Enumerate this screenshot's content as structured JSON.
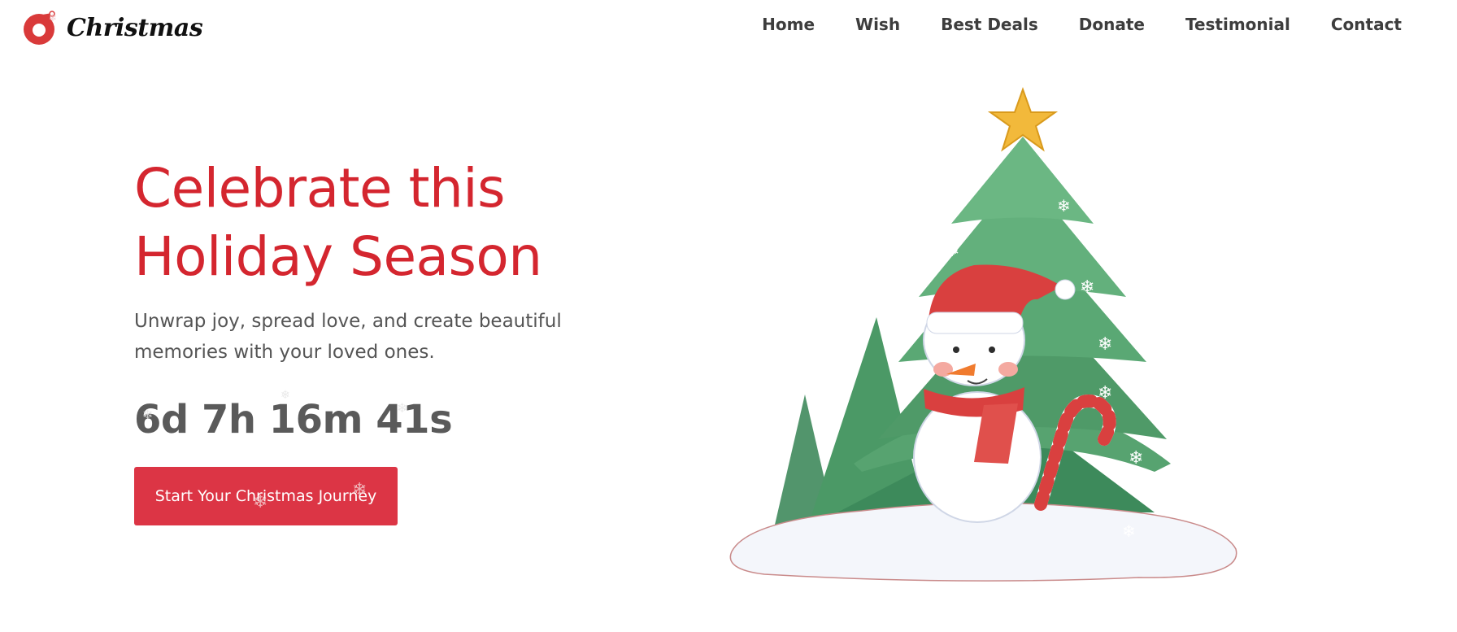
{
  "brand": {
    "name": "Christmas"
  },
  "nav": {
    "items": [
      "Home",
      "Wish",
      "Best Deals",
      "Donate",
      "Testimonial",
      "Contact"
    ]
  },
  "hero": {
    "headline_line1": "Celebrate this",
    "headline_line2": "Holiday Season",
    "subtext": "Unwrap joy, spread love, and create beautiful memories with your loved ones.",
    "countdown": "6d 7h 16m 41s",
    "cta_label": "Start Your Christmas Journey"
  },
  "colors": {
    "accent": "#dc3545",
    "headline": "#d4262f",
    "nav_text": "#3d3d3d",
    "tree": "#4f9a68",
    "star": "#f2b93b"
  },
  "icons": {
    "logo": "christmas-bauble-logo-icon",
    "illustration": "snowman-christmas-tree-illustration"
  }
}
